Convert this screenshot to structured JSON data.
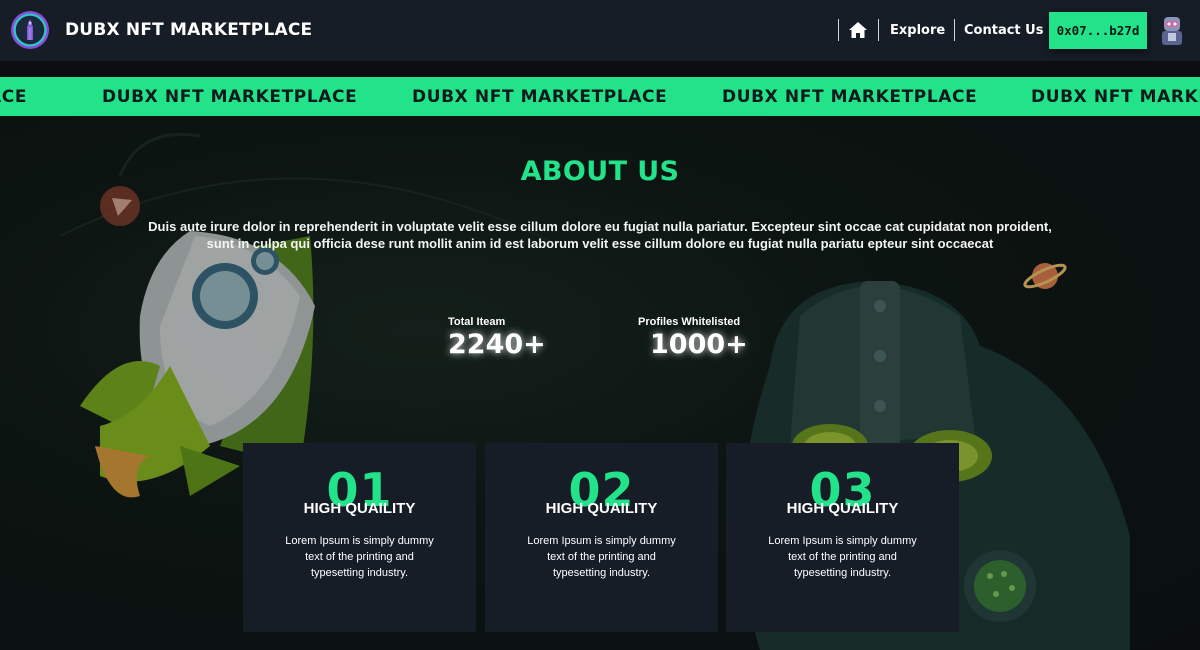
{
  "header": {
    "brand": "DUBX NFT MARKETPLACE",
    "nav": {
      "explore": "Explore",
      "contact": "Contact Us"
    },
    "wallet": "0x07...b27d",
    "icons": [
      "logo-icon",
      "home-icon",
      "avatar-icon"
    ]
  },
  "marquee": {
    "items": [
      "ACE",
      "DUBX NFT MARKETPLACE",
      "DUBX NFT MARKETPLACE",
      "DUBX NFT MARKETPLACE",
      "DUBX NFT MARKE"
    ]
  },
  "about": {
    "title": "ABOUT US",
    "line1": "Duis aute irure dolor in reprehenderit in voluptate velit esse cillum dolore eu fugiat nulla pariatur. Excepteur sint occae cat cupidatat non proident,",
    "line2": "sunt in culpa qui officia dese runt mollit anim id est laborum velit esse cillum dolore eu fugiat nulla pariatu epteur sint occaecat"
  },
  "stats": [
    {
      "label": "Total Iteam",
      "value": "2240+"
    },
    {
      "label": "Profiles Whitelisted",
      "value": "1000+"
    }
  ],
  "cards": [
    {
      "number": "01",
      "title": "HIGH QUAILITY",
      "desc": "Lorem Ipsum is simply dummy text of the printing and typesetting industry."
    },
    {
      "number": "02",
      "title": "HIGH QUAILITY",
      "desc": "Lorem Ipsum is simply dummy text of the printing and typesetting industry."
    },
    {
      "number": "03",
      "title": "HIGH QUAILITY",
      "desc": "Lorem Ipsum is simply dummy text of the printing and typesetting industry."
    }
  ],
  "colors": {
    "accent": "#22e38a",
    "header_bg": "#161d27",
    "page_bg": "#0b0f12",
    "card_bg": "#161d27"
  }
}
